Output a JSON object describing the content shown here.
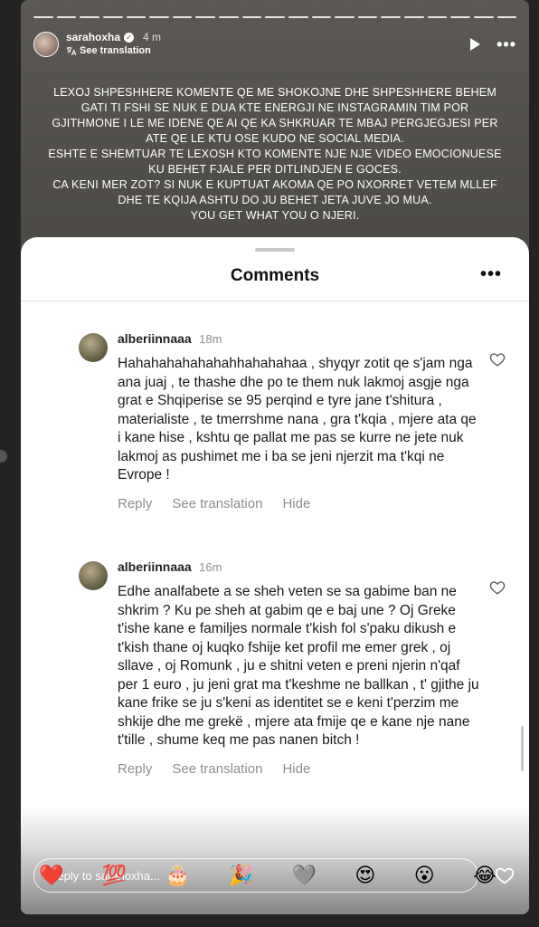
{
  "story": {
    "username": "sarahoxha",
    "time": "4 m",
    "see_translation": "See translation",
    "caption": "LEXOJ SHPESHHERE KOMENTE QE ME SHOKOJNE DHE SHPESHHERE BEHEM GATI TI FSHI SE NUK E DUA KTE ENERGJI NE INSTAGRAMIN TIM POR GJITHMONE I LE ME IDENE QE AI QE KA SHKRUAR TE MBAJ PERGJEGJESI PER ATE QE LE KTU OSE KUDO NE SOCIAL MEDIA.\nESHTE E SHEMTUAR TE LEXOSH KTO KOMENTE NJE NJE VIDEO EMOCIONUESE KU BEHET FJALE PER DITLINDJEN E GOCES.\nCA KENI MER ZOT? SI NUK E KUPTUAT AKOMA QE PO NXORRET VETEM MLLEF DHE TE KQIJA ASHTU DO JU BEHET JETA JUVE JO MUA.\nYOU GET WHAT YOU O NJERI."
  },
  "sheet": {
    "title": "Comments"
  },
  "comments": [
    {
      "user": "alberiinnaaa",
      "time": "18m",
      "text": "Hahahahahahahahhahahahaa , shyqyr zotit qe s'jam nga ana juaj , te thashe dhe po te them nuk lakmoj asgje nga grat e Shqiperise se 95 perqind e tyre jane t'shitura , materialiste , te tmerrshme nana , gra t'kqia , mjere ata qe i kane hise , kshtu qe pallat me pas se kurre ne jete nuk lakmoj as pushimet me i ba se jeni njerzit ma t'kqi ne Evrope !",
      "reply": "Reply",
      "translate": "See translation",
      "hide": "Hide"
    },
    {
      "user": "alberiinnaaa",
      "time": "16m",
      "text": "Edhe analfabete a se sheh veten se sa gabime ban ne shkrim ? Ku pe sheh at gabim qe e baj une ? Oj Greke t'ishe kane e familjes normale t'kish fol s'paku dikush e t'kish thane oj kuqko fshije ket profil me emer grek , oj sllave , oj Romunk , ju e shitni veten e preni njerin n'qaf per 1 euro , ju jeni grat ma t'keshme ne ballkan , t' gjithe ju kane frike se ju s'keni as identitet se e keni t'perzim me shkije dhe me grekë , mjere ata fmije qe e kane nje nane t'tille , shume keq me pas nanen bitch !",
      "reply": "Reply",
      "translate": "See translation",
      "hide": "Hide"
    }
  ],
  "reply_bar": {
    "placeholder": "Reply to sarahoxha..."
  },
  "emoji_bar": [
    "❤️",
    "💯",
    "🎂",
    "🎉",
    "🩶",
    "😍",
    "😮",
    "😂"
  ]
}
